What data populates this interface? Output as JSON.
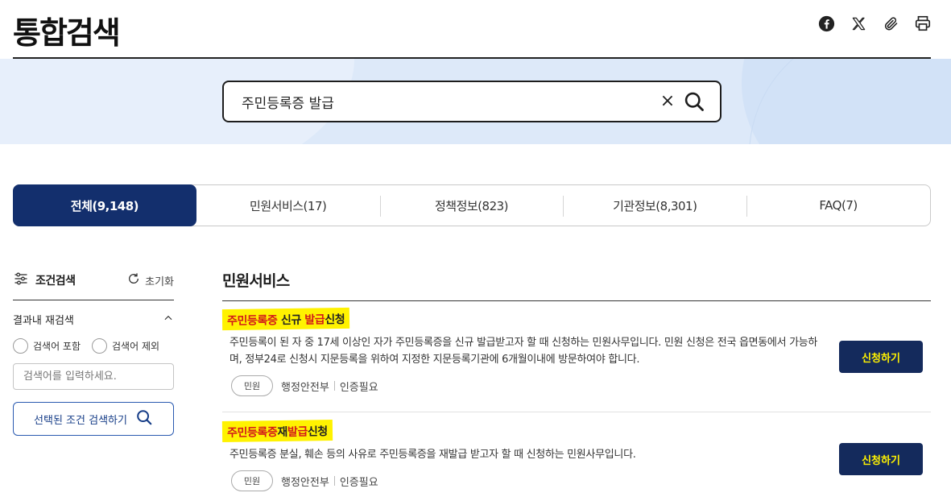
{
  "header": {
    "title": "통합검색",
    "share_icons": [
      "facebook-icon",
      "x-twitter-icon",
      "paperclip-icon",
      "printer-icon"
    ]
  },
  "search": {
    "value": "주민등록증 발급",
    "clear_glyph": "×"
  },
  "tabs": [
    {
      "label": "전체(9,148)",
      "active": true
    },
    {
      "label": "민원서비스(17)",
      "active": false
    },
    {
      "label": "정책정보(823)",
      "active": false
    },
    {
      "label": "기관정보(8,301)",
      "active": false
    },
    {
      "label": "FAQ(7)",
      "active": false
    }
  ],
  "filter": {
    "title": "조건검색",
    "reset_label": "초기화",
    "refine_label": "결과내 재검색",
    "radio_include": "검색어 포함",
    "radio_exclude": "검색어 제외",
    "placeholder": "검색어를 입력하세요.",
    "apply_label": "선택된 조건 검색하기"
  },
  "results": {
    "section_title": "민원서비스",
    "items": [
      {
        "title_parts": [
          "주민등록증",
          " 신규 ",
          "발급",
          "신청"
        ],
        "description": "주민등록이 된 자 중 17세 이상인 자가 주민등록증을 신규 발급받고자 할 때 신청하는 민원사무입니다. 민원 신청은 전국 읍면동에서 가능하며, 정부24로 신청시 지문등록을 위하여 지정한 지문등록기관에 6개월이내에 방문하여야 합니다.",
        "chip": "민원",
        "agency": "행정안전부",
        "auth": "인증필요",
        "button": "신청하기"
      },
      {
        "title_parts": [
          "주민등록증",
          "재",
          "발급",
          "신청"
        ],
        "description": "주민등록증 분실, 훼손 등의 사유로 주민등록증을 재발급 받고자 할 때 신청하는 민원사무입니다.",
        "chip": "민원",
        "agency": "행정안전부",
        "auth": "인증필요",
        "button": "신청하기"
      }
    ]
  },
  "colors": {
    "navy": "#132f6d",
    "highlight": "#fff200",
    "keyword_red": "#d21a1a"
  }
}
